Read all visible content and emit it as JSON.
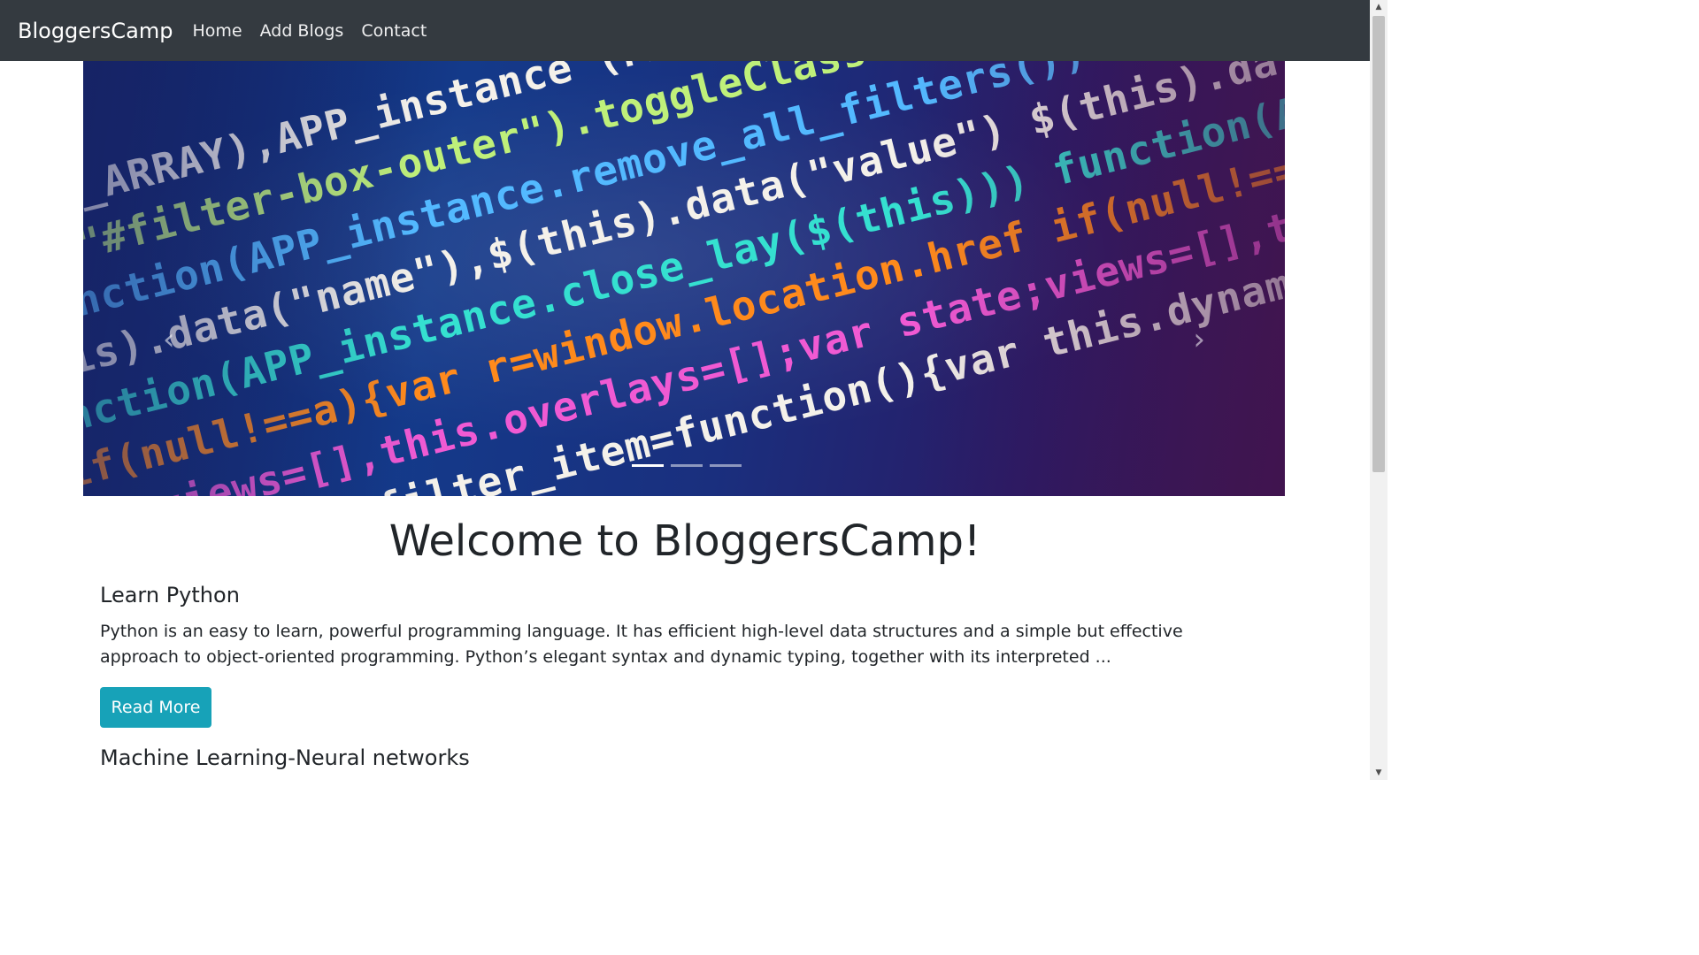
{
  "navbar": {
    "brand": "BloggersCamp",
    "links": [
      {
        "label": "Home"
      },
      {
        "label": "Add Blogs"
      },
      {
        "label": "Contact"
      }
    ]
  },
  "carousel": {
    "image": "code-screen-image",
    "prev_icon": "chevron-left-icon",
    "next_icon": "chevron-right-icon",
    "prev_glyph": "‹",
    "next_glyph": "›",
    "active_slide": 1,
    "slide_count": 3,
    "code_lines": [
      [
        "(PAGES_ARRAY),APP_instance",
        "c-w"
      ],
      [
        "O($(\"#filter-box-outer\").toggleClass",
        "c-g"
      ],
      [
        "function(APP_instance.remove_all_filters())",
        "c-b"
      ],
      [
        "$(this).data(\"name\"),$(this).data(\"value\")",
        "c-w"
      ],
      [
        "function(APP_instance.close_lay($(this)))",
        "c-c"
      ],
      [
        "if(null!==a){var r=window.location.href",
        "c-o"
      ],
      [
        "state;views=[],this.overlays=[];var",
        "c-p"
      ],
      [
        "this.dynamic_filter_item=function(){var",
        "c-w"
      ]
    ]
  },
  "main": {
    "title": "Welcome to BloggersCamp!"
  },
  "posts": [
    {
      "title": "Learn Python",
      "excerpt": "Python is an easy to learn, powerful programming language. It has efficient high-level data structures and a simple but effective approach to object-oriented programming. Python’s elegant syntax and dynamic typing, together with its interpreted ...",
      "button_label": "Read More"
    },
    {
      "title": "Machine Learning-Neural networks"
    }
  ],
  "colors": {
    "navbar_bg": "#343a40",
    "button_bg": "#17a2b8"
  },
  "scrollbar": {
    "up_icon": "scroll-up-arrow-icon",
    "down_icon": "scroll-down-arrow-icon",
    "up_glyph": "▲",
    "down_glyph": "▼"
  }
}
